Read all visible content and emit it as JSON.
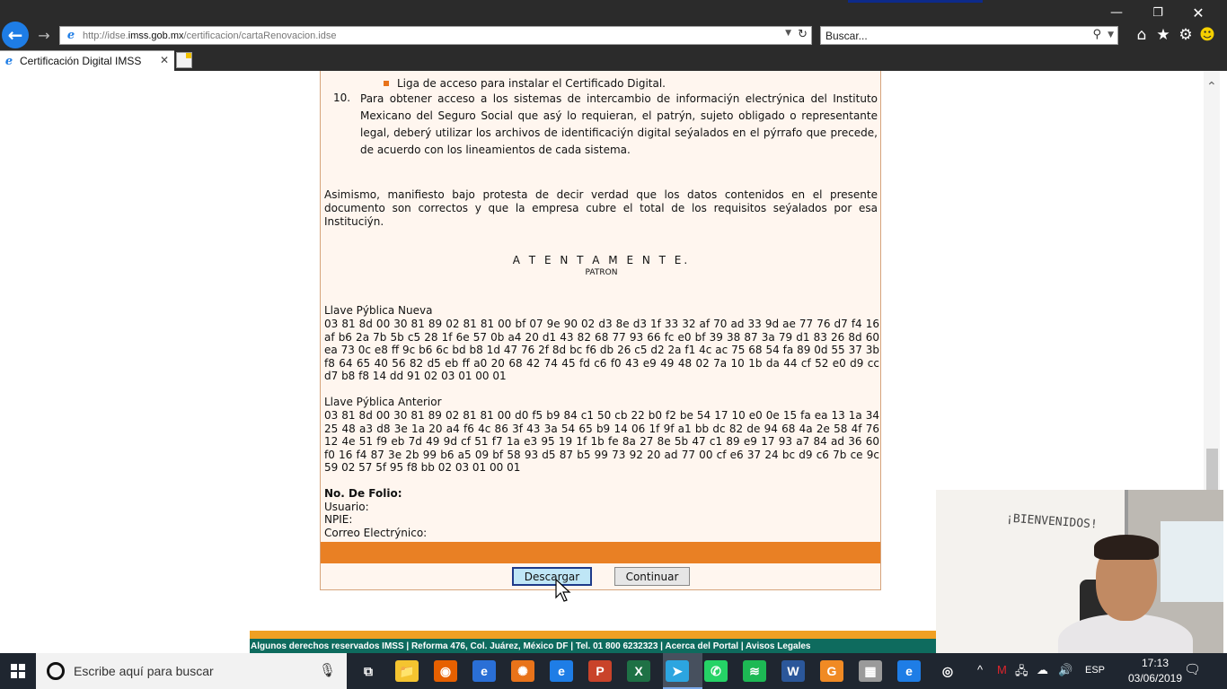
{
  "browser": {
    "url_prefix": "http://idse.",
    "url_host": "imss.gob.mx",
    "url_path": "/certificacion/cartaRenovacion.idse",
    "search_placeholder": "Buscar...",
    "tab_title": "Certificación Digital IMSS",
    "icons": [
      "back-arrow-icon",
      "forward-arrow-icon",
      "refresh-icon",
      "search-icon",
      "home-icon",
      "star-icon",
      "gear-icon",
      "smiley-icon"
    ]
  },
  "document": {
    "bullet_text": "Liga de acceso para instalar el Certificado Digital.",
    "item_number": "10.",
    "item_text": "Para obtener acceso a los sistemas de intercambio de informaciýn electrýnica del Instituto Mexicano del Seguro Social que asý lo requieran, el patrýn, sujeto obligado o representante legal, deberý utilizar los archivos de identificaciýn digital seýalados en el pýrrafo que precede, de acuerdo con los lineamientos de cada sistema.",
    "protest_text": "Asimismo, manifiesto bajo protesta de decir verdad que los datos contenidos en el presente documento son correctos y que la empresa cubre el total de los requisitos seýalados por esa Instituciýn.",
    "atentamente": "A T E N T A M E N T E.",
    "patron": "PATRON",
    "new_key_label": "Llave Pýblica Nueva",
    "new_key_hex": "03 81 8d 00 30 81 89 02 81 81 00 bf 07 9e 90 02 d3 8e d3 1f 33 32 af 70 ad 33 9d ae 77 76 d7 f4 16 af b6 2a 7b 5b c5 28 1f 6e 57 0b a4 20 d1 43 82 68 77 93 66 fc e0 bf 39 38 87 3a 79 d1 83 26 8d 60 ea 73 0c e8 ff 9c b6 6c bd b8 1d 47 76 2f 8d bc f6 db 26 c5 d2 2a f1 4c ac 75 68 54 fa 89 0d 55 37 3b f8 64 65 40 56 82 d5 eb ff a0 20 68 42 74 45 fd c6 f0 43 e9 49 48 02 7a 10 1b da 44 cf 52 e0 d9 cc d7 b8 f8 14 dd 91 02 03 01 00 01",
    "old_key_label": "Llave Pýblica Anterior",
    "old_key_hex": "03 81 8d 00 30 81 89 02 81 81 00 d0 f5 b9 84 c1 50 cb 22 b0 f2 be 54 17 10 e0 0e 15 fa ea 13 1a 34 25 48 a3 d8 3e 1a 20 a4 f6 4c 86 3f 43 3a 54 65 b9 14 06 1f 9f a1 bb dc 82 de 94 68 4a 2e 58 4f 76 12 4e 51 f9 eb 7d 49 9d cf 51 f7 1a e3 95 19 1f 1b fe 8a 27 8e 5b 47 c1 89 e9 17 93 a7 84 ad 36 60 f0 16 f4 87 3e 2b 99 b6 a5 09 bf 58 93 d5 87 b5 99 73 92 20 ad 77 00 cf e6 37 24 bc d9 c6 7b ce 9c 59 02 57 5f 95 f8 bb 02 03 01 00 01",
    "folio_label": "No. De Folio:",
    "usuario_label": "Usuario:",
    "npie_label": "NPIE:",
    "correo_label": "Correo Electrýnico:",
    "download_label": "Descargar",
    "continue_label": "Continuar"
  },
  "footer": {
    "text": "Algunos derechos reservados IMSS | Reforma 476, Col. Juárez, México DF | Tel. 01 800 6232323 | Acerca del Portal | Avisos Legales"
  },
  "webcam": {
    "board_text": "¡BIENVENIDOS!"
  },
  "taskbar": {
    "search_placeholder": "Escribe aquí para buscar",
    "apps": [
      {
        "name": "task-view",
        "glyph": "⧉",
        "color": "#1f2630"
      },
      {
        "name": "file-explorer",
        "glyph": "📁",
        "color": "#f4c430"
      },
      {
        "name": "firefox",
        "glyph": "◉",
        "color": "#e66000"
      },
      {
        "name": "edge-legacy",
        "glyph": "e",
        "color": "#2a6fd6"
      },
      {
        "name": "app-orange-gear",
        "glyph": "✺",
        "color": "#e8731a"
      },
      {
        "name": "internet-explorer",
        "glyph": "e",
        "color": "#1e7de6"
      },
      {
        "name": "powerpoint",
        "glyph": "P",
        "color": "#c9432a"
      },
      {
        "name": "excel",
        "glyph": "X",
        "color": "#1e7145"
      },
      {
        "name": "telegram",
        "glyph": "➤",
        "color": "#2ca5e0"
      },
      {
        "name": "whatsapp",
        "glyph": "✆",
        "color": "#25d366"
      },
      {
        "name": "spotify",
        "glyph": "≋",
        "color": "#1db954"
      },
      {
        "name": "word",
        "glyph": "W",
        "color": "#2b579a"
      },
      {
        "name": "app-orange",
        "glyph": "G",
        "color": "#f08a24"
      },
      {
        "name": "app-grey-doc",
        "glyph": "▦",
        "color": "#9a9a9a"
      },
      {
        "name": "internet-explorer-2",
        "glyph": "e",
        "color": "#1e7de6"
      },
      {
        "name": "cortana-ring",
        "glyph": "◎",
        "color": "#1f2630"
      }
    ],
    "language": "ESP",
    "time": "17:13",
    "date": "03/06/2019"
  }
}
